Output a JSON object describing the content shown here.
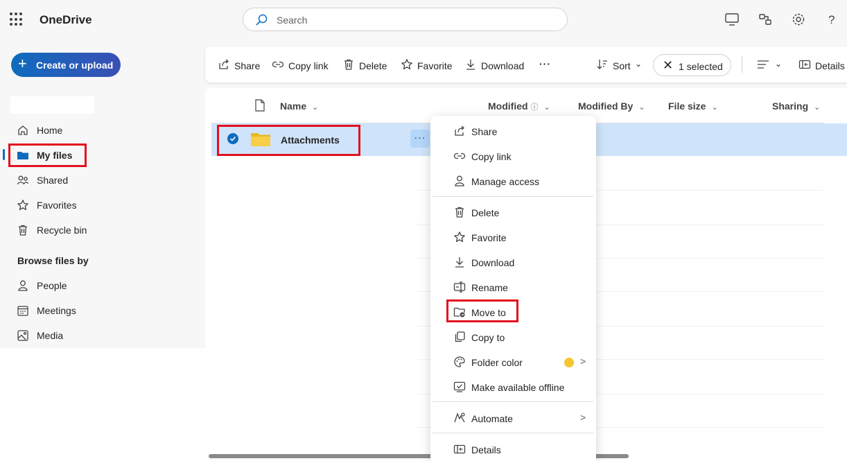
{
  "app": {
    "name": "OneDrive"
  },
  "search": {
    "placeholder": "Search"
  },
  "sidebar": {
    "create_button": "Create or upload",
    "items": [
      {
        "label": "Home",
        "icon": "home-icon"
      },
      {
        "label": "My files",
        "icon": "folder-icon",
        "active": true
      },
      {
        "label": "Shared",
        "icon": "people-icon"
      },
      {
        "label": "Favorites",
        "icon": "star-icon"
      },
      {
        "label": "Recycle bin",
        "icon": "recycle-bin-icon"
      }
    ],
    "browse_heading": "Browse files by",
    "browse_items": [
      {
        "label": "People",
        "icon": "person-icon"
      },
      {
        "label": "Meetings",
        "icon": "calendar-icon"
      },
      {
        "label": "Media",
        "icon": "image-icon"
      }
    ]
  },
  "toolbar": {
    "share": "Share",
    "copy_link": "Copy link",
    "delete": "Delete",
    "favorite": "Favorite",
    "download": "Download",
    "more": "···",
    "sort": "Sort",
    "selected": "1 selected",
    "details": "Details"
  },
  "columns": {
    "name": "Name",
    "modified": "Modified",
    "modified_by": "Modified By",
    "file_size": "File size",
    "sharing": "Sharing"
  },
  "files": [
    {
      "name": "Attachments",
      "type": "folder",
      "selected": true
    }
  ],
  "context_menu": {
    "items": [
      {
        "label": "Share",
        "icon": "share-icon"
      },
      {
        "label": "Copy link",
        "icon": "link-icon"
      },
      {
        "label": "Manage access",
        "icon": "person-icon"
      },
      {
        "label": "Delete",
        "icon": "trash-icon"
      },
      {
        "label": "Favorite",
        "icon": "star-icon"
      },
      {
        "label": "Download",
        "icon": "download-icon"
      },
      {
        "label": "Rename",
        "icon": "rename-icon"
      },
      {
        "label": "Move to",
        "icon": "move-icon"
      },
      {
        "label": "Copy to",
        "icon": "copy-icon"
      },
      {
        "label": "Folder color",
        "icon": "palette-icon",
        "swatch": "#f5c62f"
      },
      {
        "label": "Make available offline",
        "icon": "offline-icon"
      },
      {
        "label": "Automate",
        "icon": "automate-icon"
      },
      {
        "label": "Details",
        "icon": "details-icon"
      }
    ]
  },
  "colors": {
    "accent": "#0f6cbd",
    "selection": "#cfe4fa",
    "highlight": "#e3101d",
    "folder": "#f5c62f"
  }
}
